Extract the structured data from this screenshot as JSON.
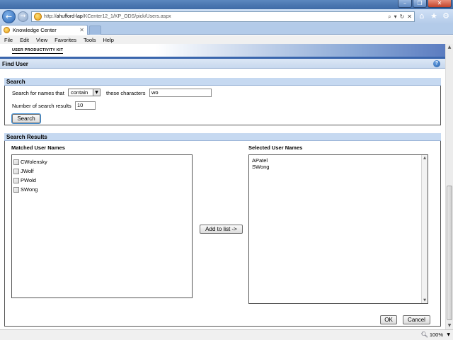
{
  "browser": {
    "url_prefix": "http://",
    "url_host": "ahufford-lap",
    "url_path": "/KCenter12_1/KP_ODS/pick/Users.aspx",
    "tab_title": "Knowledge Center",
    "menu": [
      "File",
      "Edit",
      "View",
      "Favorites",
      "Tools",
      "Help"
    ],
    "zoom": "100%",
    "window_buttons": [
      "minimize",
      "restore",
      "close"
    ],
    "toolbar_icons": [
      "home-icon",
      "favorites-star-icon",
      "tools-gear-icon"
    ]
  },
  "page": {
    "brand_label": "USER PRODUCTIVITY KIT",
    "title": "Find User",
    "help_symbol": "?",
    "search": {
      "section_title": "Search",
      "label_search_for": "Search for names that",
      "match_mode": "contain",
      "label_characters": "these characters",
      "characters_value": "wo",
      "label_count": "Number of search results",
      "count_value": "10",
      "button": "Search"
    },
    "results": {
      "section_title": "Search Results",
      "matched_title": "Matched User Names",
      "matched": [
        "CWolensky",
        "JWolf",
        "PWold",
        "SWong"
      ],
      "add_button": "Add to list ->",
      "selected_title": "Selected User Names",
      "selected": [
        "APatel",
        "SWong"
      ],
      "ok_button": "OK",
      "cancel_button": "Cancel"
    }
  }
}
